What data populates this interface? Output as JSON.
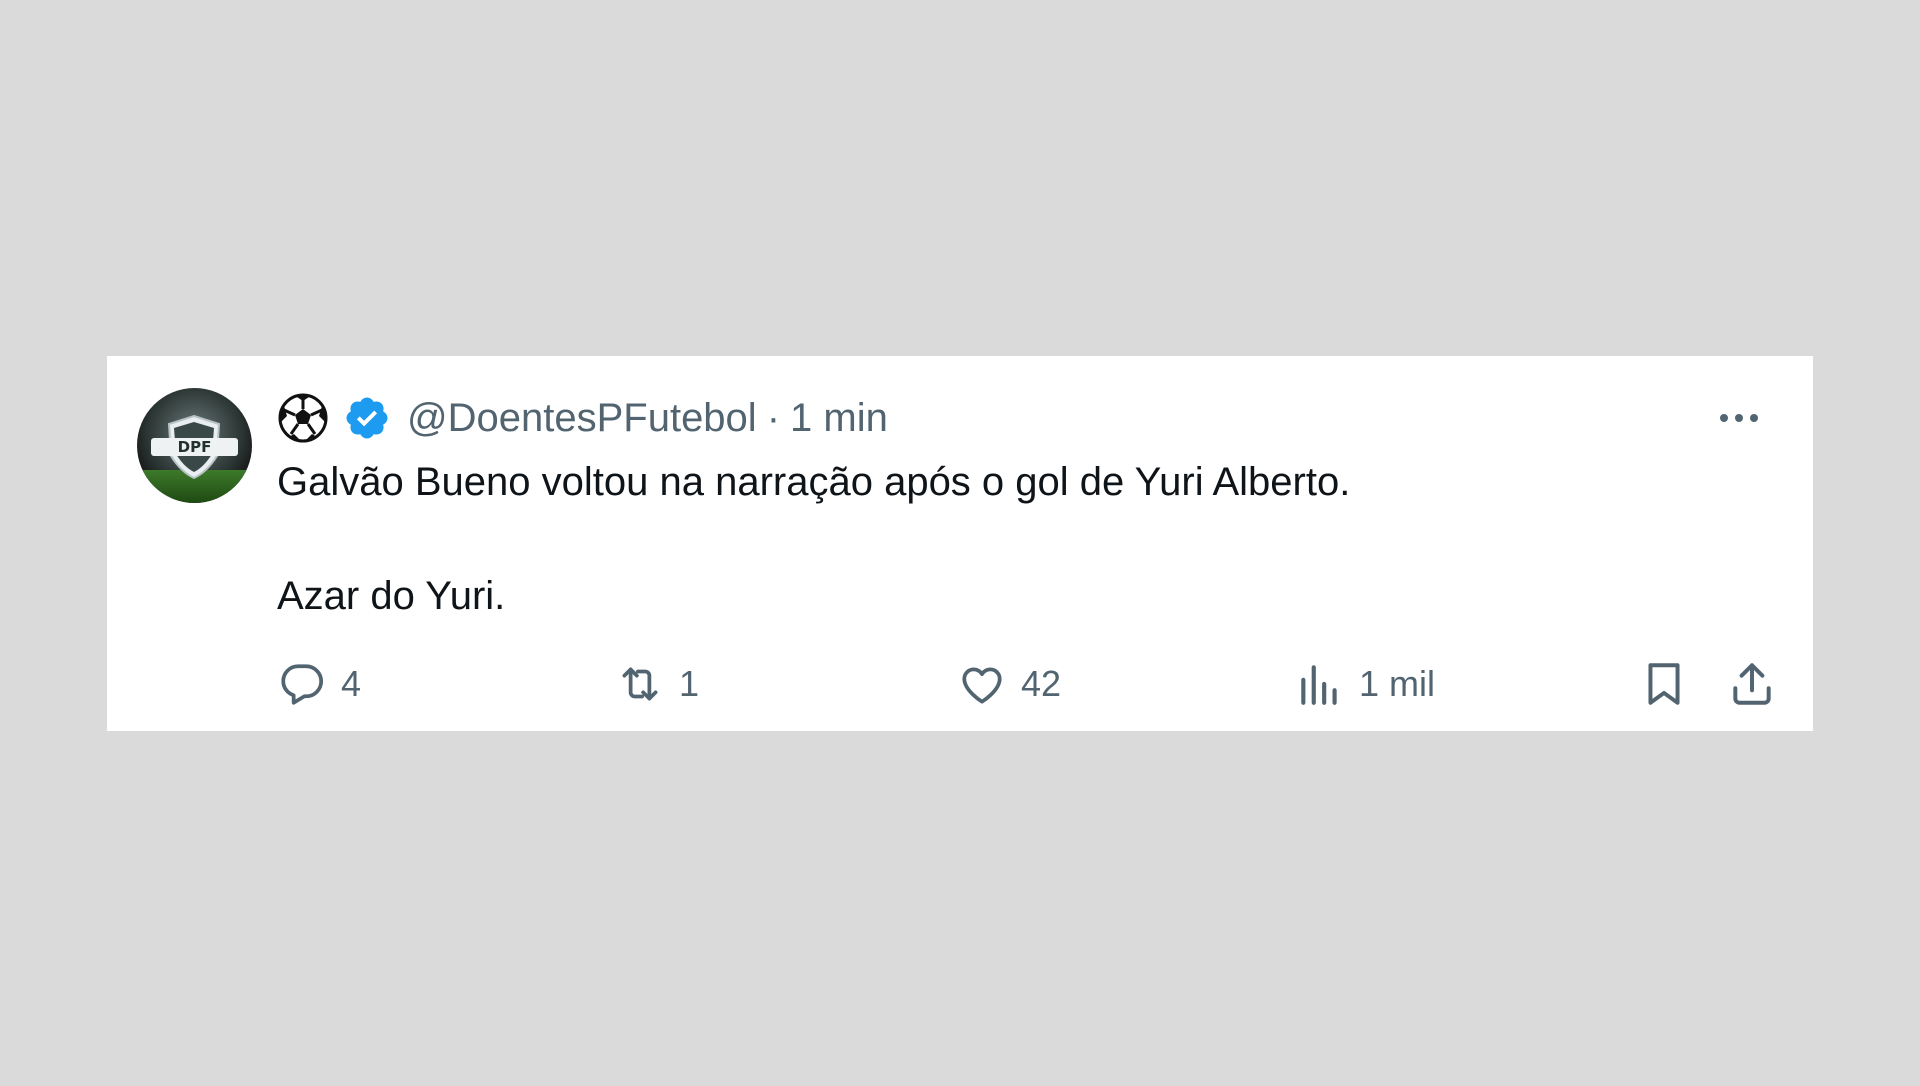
{
  "tweet": {
    "emoji_icon": "soccer-ball-icon",
    "verified_icon": "verified-badge-icon",
    "handle": "@DoentesPFutebol",
    "separator": "·",
    "time": "1 min",
    "lines": [
      "Galvão Bueno voltou na narração após o gol de Yuri Alberto.",
      "Azar do Yuri."
    ],
    "avatar_text": "DPF"
  },
  "actions": {
    "replies": "4",
    "retweets": "1",
    "likes": "42",
    "views": "1 mil"
  },
  "colors": {
    "background": "#dadada",
    "card": "#ffffff",
    "text": "#0f1419",
    "muted": "#536471",
    "verified": "#1d9bf0"
  }
}
